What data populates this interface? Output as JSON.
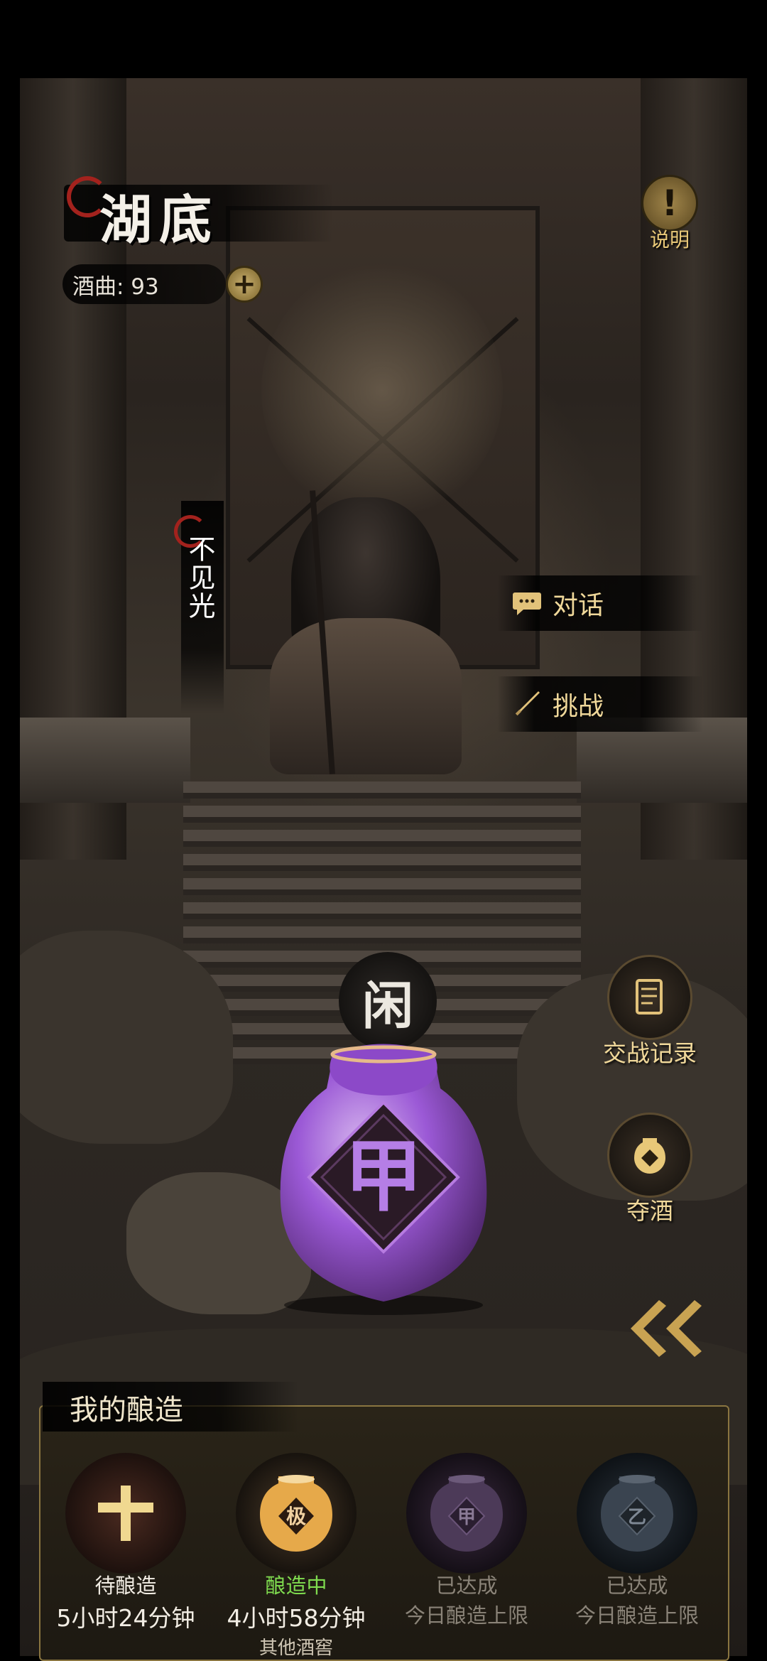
{
  "header": {
    "location_title": "湖底",
    "currency_label": "酒曲: 93",
    "help_label": "说明"
  },
  "npc": {
    "name": "不见光"
  },
  "actions": [
    {
      "label": "对话",
      "icon": "chat-bubble-icon"
    },
    {
      "label": "挑战",
      "icon": "sword-icon"
    }
  ],
  "side": {
    "battle_record_label": "交战记录",
    "seize_wine_label": "夺酒"
  },
  "jar": {
    "status_badge": "闲",
    "grade": "甲"
  },
  "brewing": {
    "title": "我的酿造",
    "slots": [
      {
        "status": "待酿造",
        "time": "5小时24分钟",
        "sub": "",
        "icon": "plus-icon"
      },
      {
        "status": "酿造中",
        "time": "4小时58分钟",
        "sub": "其他酒窖",
        "jar_mark": "极",
        "icon": "wine-jar-icon"
      },
      {
        "status": "已达成",
        "time": "今日酿造上限",
        "sub": "",
        "jar_mark": "甲",
        "icon": "wine-jar-icon"
      },
      {
        "status": "已达成",
        "time": "今日酿造上限",
        "sub": "",
        "jar_mark": "乙",
        "icon": "wine-jar-icon"
      }
    ]
  },
  "colors": {
    "gold": "#f0d89a",
    "brewing_green": "#7fdc4f",
    "purple_jar": "#9b59d6"
  }
}
